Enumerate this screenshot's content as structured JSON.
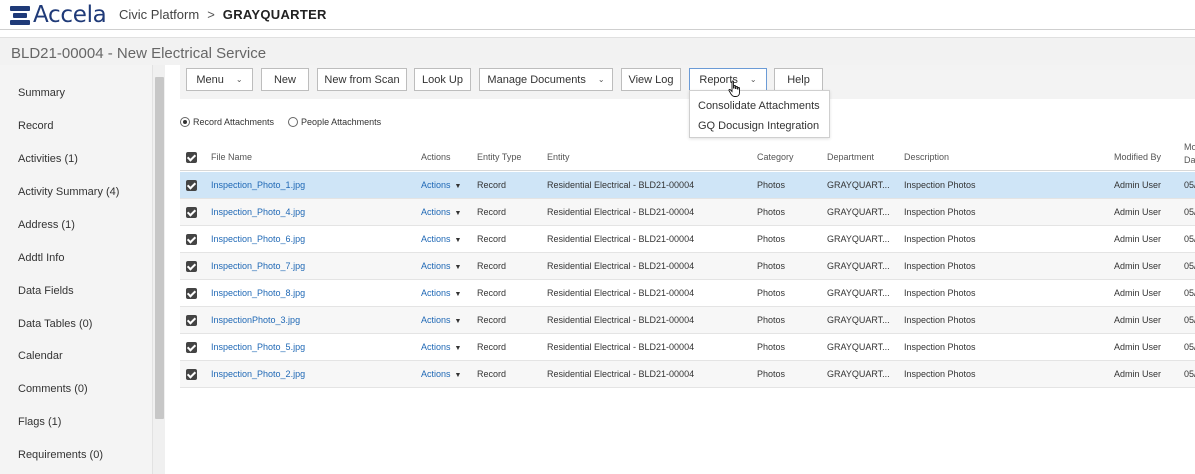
{
  "header": {
    "logo_text": "Accela",
    "app_name": "Civic Platform",
    "breadcrumb_sep": ">",
    "agency": "GRAYQUARTER"
  },
  "record": {
    "title": "BLD21-00004 - New Electrical Service"
  },
  "sidebar": {
    "items": [
      {
        "label": "Summary"
      },
      {
        "label": "Record"
      },
      {
        "label": "Activities (1)"
      },
      {
        "label": "Activity Summary (4)"
      },
      {
        "label": "Address (1)"
      },
      {
        "label": "Addtl Info"
      },
      {
        "label": "Data Fields"
      },
      {
        "label": "Data Tables (0)"
      },
      {
        "label": "Calendar"
      },
      {
        "label": "Comments (0)"
      },
      {
        "label": "Flags (1)"
      },
      {
        "label": "Requirements (0)"
      }
    ]
  },
  "toolbar": {
    "menu": "Menu",
    "new": "New",
    "new_from_scan": "New from Scan",
    "look_up": "Look Up",
    "manage_documents": "Manage Documents",
    "view_log": "View Log",
    "reports": "Reports",
    "help": "Help",
    "chevron": "⌄"
  },
  "reports_menu": {
    "items": [
      "Consolidate Attachments",
      "GQ Docusign Integration"
    ]
  },
  "attachment_filter": {
    "record": "Record Attachments",
    "people": "People Attachments",
    "selected": "record"
  },
  "table": {
    "columns": {
      "file_name": "File Name",
      "actions": "Actions",
      "entity_type": "Entity Type",
      "entity": "Entity",
      "category": "Category",
      "department": "Department",
      "description": "Description",
      "modified_by": "Modified By",
      "modified_date_top": "Mo",
      "modified_date_bottom": "Da"
    },
    "action_label": "Actions",
    "action_caret": "▼",
    "rows": [
      {
        "file": "Inspection_Photo_1.jpg",
        "entity_type": "Record",
        "entity": "Residential Electrical - BLD21-00004",
        "category": "Photos",
        "department": "GRAYQUART...",
        "description": "Inspection Photos",
        "modified_by": "Admin User",
        "date": "05/"
      },
      {
        "file": "Inspection_Photo_4.jpg",
        "entity_type": "Record",
        "entity": "Residential Electrical - BLD21-00004",
        "category": "Photos",
        "department": "GRAYQUART...",
        "description": "Inspection Photos",
        "modified_by": "Admin User",
        "date": "05/"
      },
      {
        "file": "Inspection_Photo_6.jpg",
        "entity_type": "Record",
        "entity": "Residential Electrical - BLD21-00004",
        "category": "Photos",
        "department": "GRAYQUART...",
        "description": "Inspection Photos",
        "modified_by": "Admin User",
        "date": "05/"
      },
      {
        "file": "Inspection_Photo_7.jpg",
        "entity_type": "Record",
        "entity": "Residential Electrical - BLD21-00004",
        "category": "Photos",
        "department": "GRAYQUART...",
        "description": "Inspection Photos",
        "modified_by": "Admin User",
        "date": "05/"
      },
      {
        "file": "Inspection_Photo_8.jpg",
        "entity_type": "Record",
        "entity": "Residential Electrical - BLD21-00004",
        "category": "Photos",
        "department": "GRAYQUART...",
        "description": "Inspection Photos",
        "modified_by": "Admin User",
        "date": "05/"
      },
      {
        "file": "InspectionPhoto_3.jpg",
        "entity_type": "Record",
        "entity": "Residential Electrical - BLD21-00004",
        "category": "Photos",
        "department": "GRAYQUART...",
        "description": "Inspection Photos",
        "modified_by": "Admin User",
        "date": "05/"
      },
      {
        "file": "Inspection_Photo_5.jpg",
        "entity_type": "Record",
        "entity": "Residential Electrical - BLD21-00004",
        "category": "Photos",
        "department": "GRAYQUART...",
        "description": "Inspection Photos",
        "modified_by": "Admin User",
        "date": "05/"
      },
      {
        "file": "Inspection_Photo_2.jpg",
        "entity_type": "Record",
        "entity": "Residential Electrical - BLD21-00004",
        "category": "Photos",
        "department": "GRAYQUART...",
        "description": "Inspection Photos",
        "modified_by": "Admin User",
        "date": "05/"
      }
    ]
  }
}
